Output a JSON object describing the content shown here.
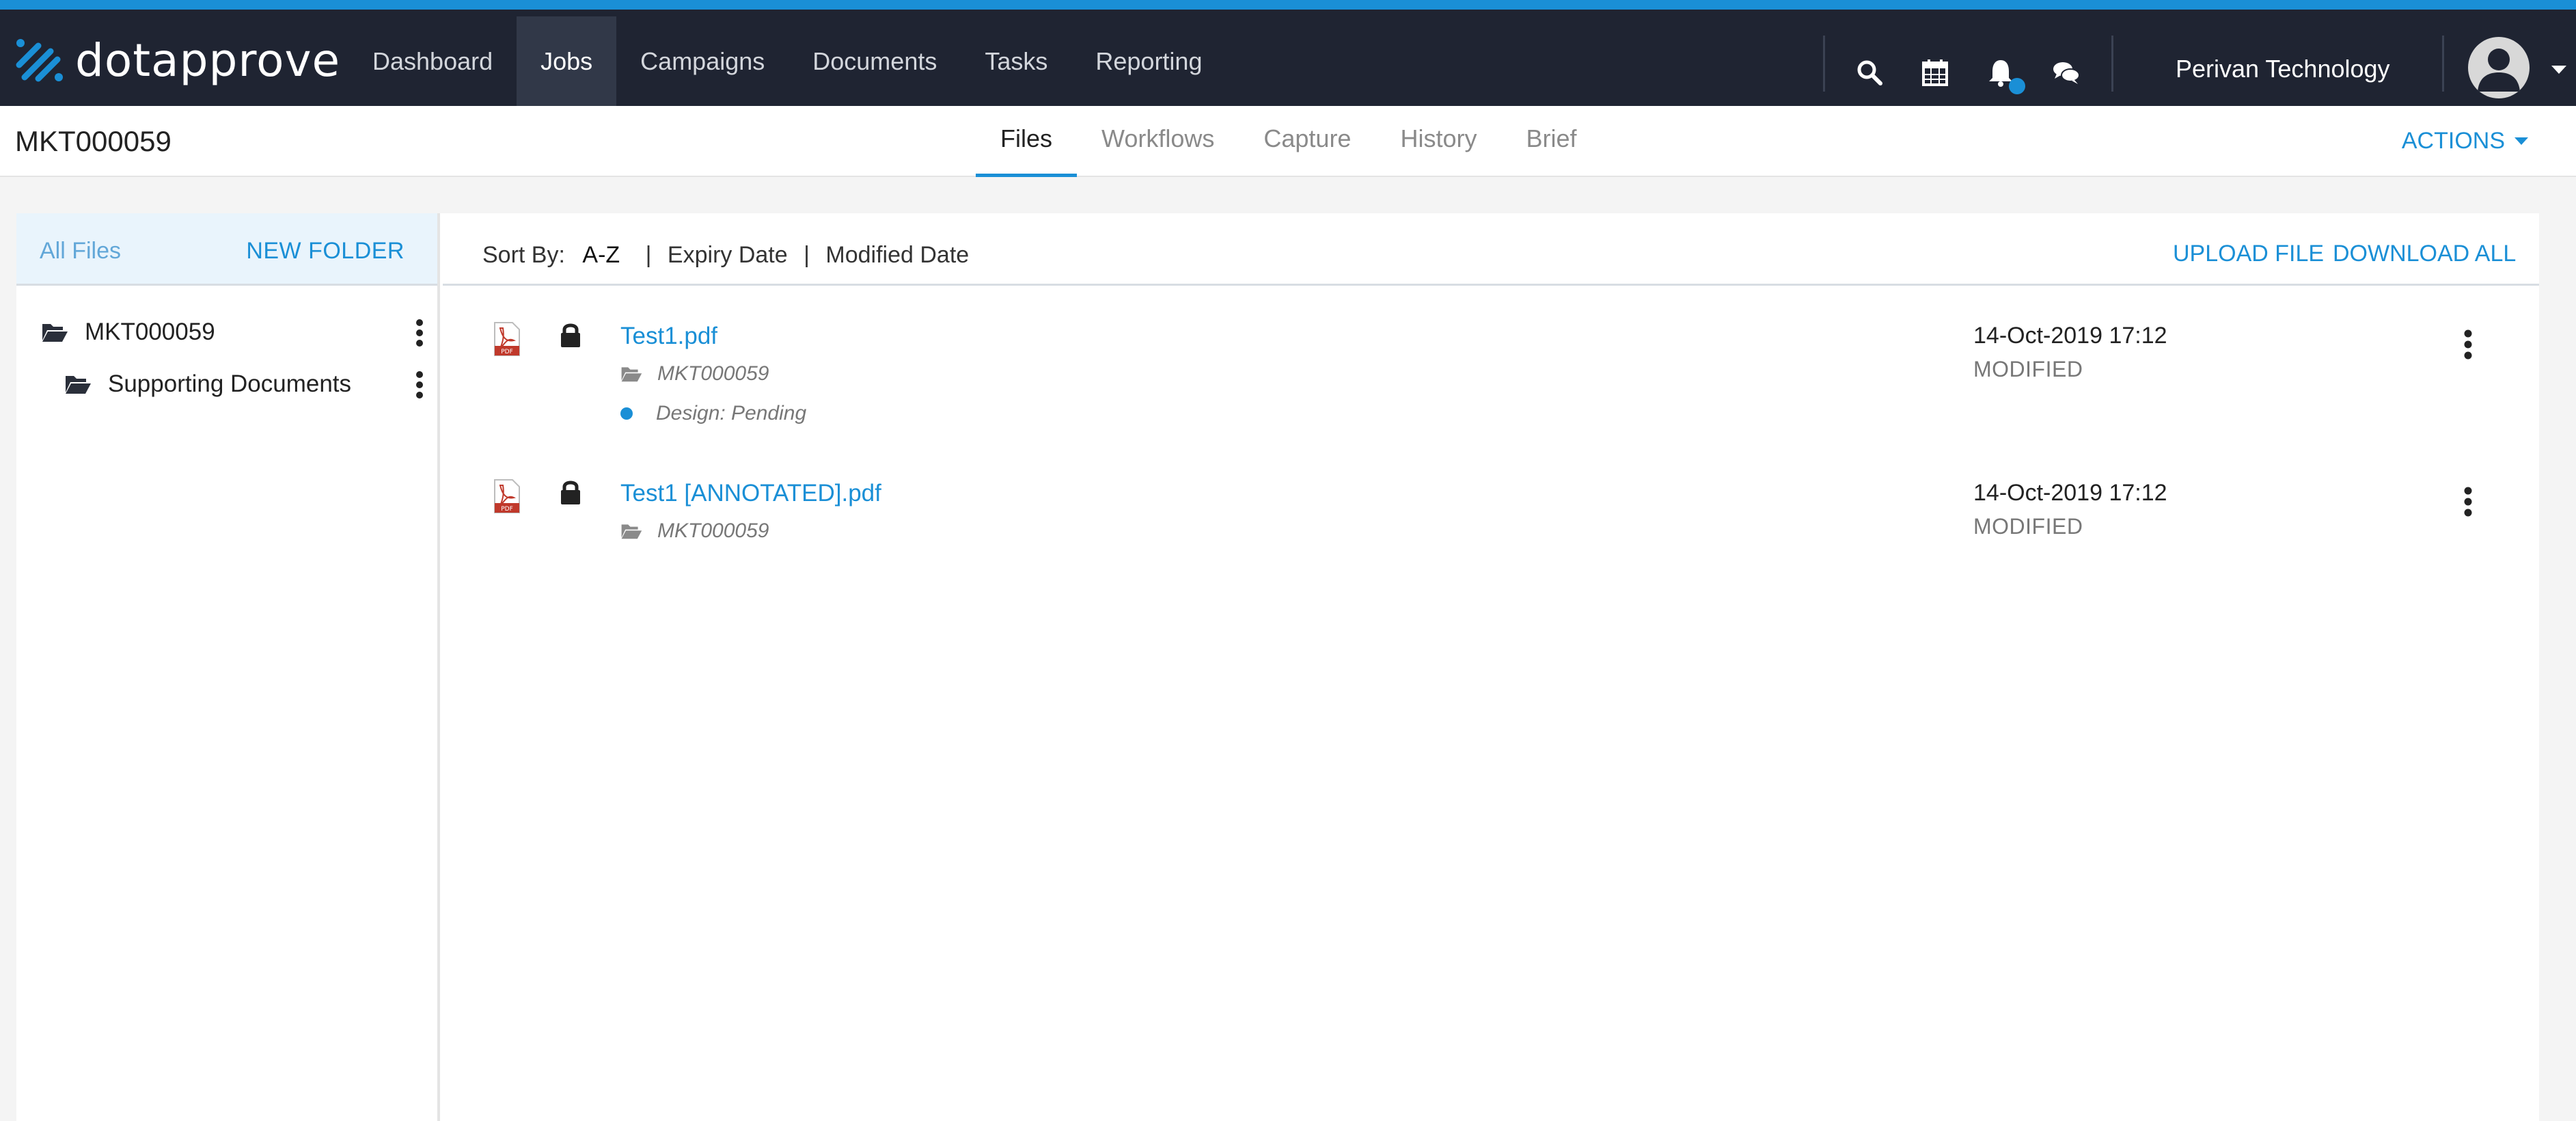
{
  "app": {
    "logo_text": "dotapprove",
    "nav": [
      "Dashboard",
      "Jobs",
      "Campaigns",
      "Documents",
      "Tasks",
      "Reporting"
    ],
    "active_nav": "Jobs",
    "org_name": "Perivan Technology",
    "icons": [
      "search-icon",
      "calendar-icon",
      "bell-icon",
      "chat-icon",
      "avatar-icon"
    ],
    "accent_color": "#1a8fd6",
    "nav_bg": "#1f2432"
  },
  "job": {
    "title": "MKT000059",
    "tabs": [
      "Files",
      "Workflows",
      "Capture",
      "History",
      "Brief"
    ],
    "active_tab": "Files",
    "actions_label": "ACTIONS"
  },
  "sidebar": {
    "all_files": "All Files",
    "new_folder": "NEW FOLDER",
    "tree": [
      {
        "label": "MKT000059"
      },
      {
        "label": "Supporting Documents"
      }
    ]
  },
  "toolbar": {
    "sort_label": "Sort By:",
    "sort_options": [
      "A-Z",
      "Expiry Date",
      "Modified Date"
    ],
    "selected_sort": "A-Z",
    "upload": "UPLOAD FILE",
    "download_all": "DOWNLOAD ALL"
  },
  "files": [
    {
      "name": "Test1.pdf",
      "folder": "MKT000059",
      "status": "Design: Pending",
      "date": "14-Oct-2019 17:12",
      "date_label": "MODIFIED"
    },
    {
      "name": "Test1 [ANNOTATED].pdf",
      "folder": "MKT000059",
      "date": "14-Oct-2019 17:12",
      "date_label": "MODIFIED"
    }
  ]
}
